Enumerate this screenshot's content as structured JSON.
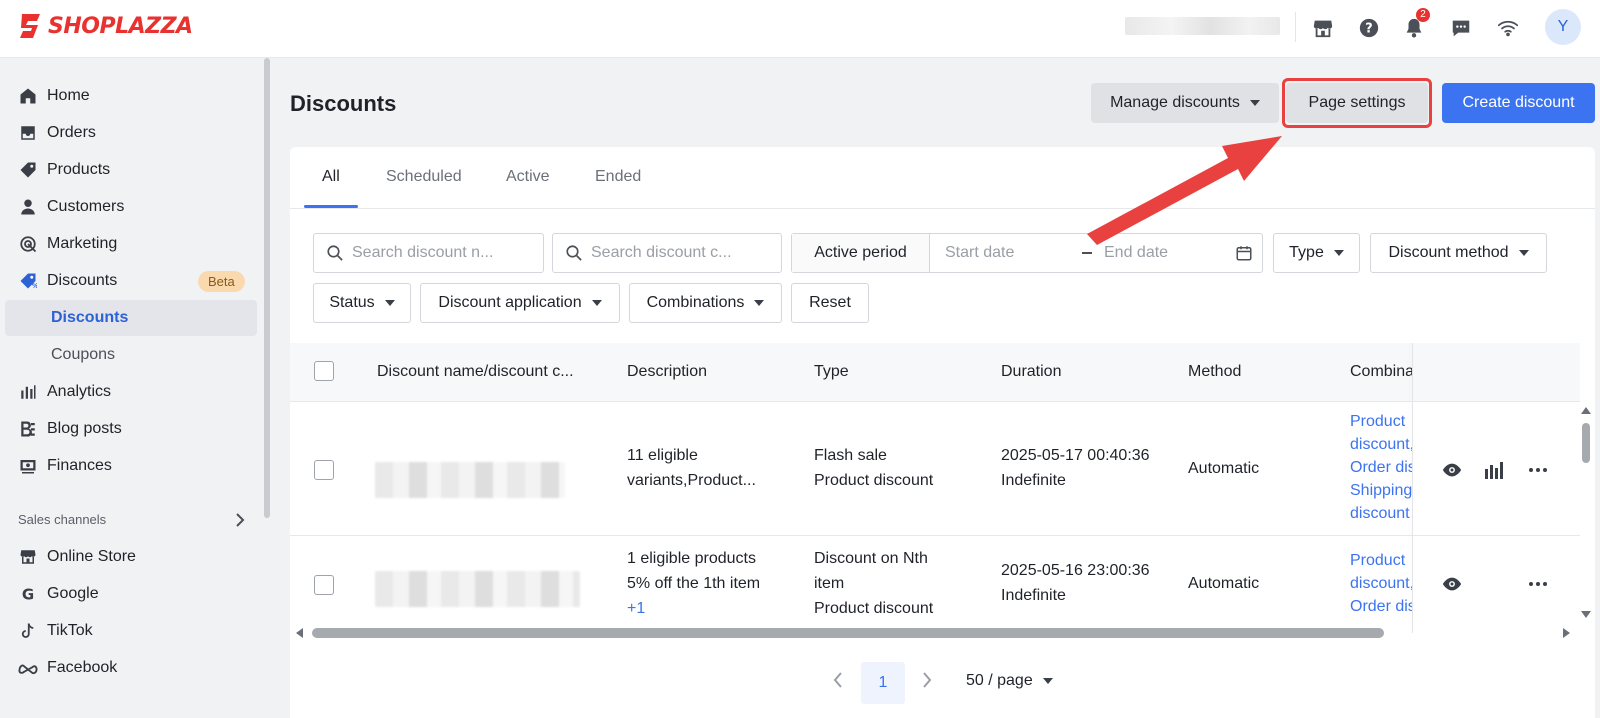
{
  "brand": {
    "name": "SHOPLAZZA",
    "accent": "#e9322f"
  },
  "topbar": {
    "notification_count": "2",
    "avatar_initial": "Y"
  },
  "sidebar": {
    "items": [
      {
        "label": "Home",
        "icon": "home-icon"
      },
      {
        "label": "Orders",
        "icon": "inbox-icon"
      },
      {
        "label": "Products",
        "icon": "tag-icon"
      },
      {
        "label": "Customers",
        "icon": "person-icon"
      },
      {
        "label": "Marketing",
        "icon": "target-icon"
      },
      {
        "label": "Discounts",
        "icon": "discount-tag-icon",
        "badge": "Beta"
      },
      {
        "label": "Discounts",
        "sub": true,
        "selected": true
      },
      {
        "label": "Coupons",
        "sub": true
      },
      {
        "label": "Analytics",
        "icon": "bar-chart-icon"
      },
      {
        "label": "Blog posts",
        "icon": "blog-icon"
      },
      {
        "label": "Finances",
        "icon": "finance-icon"
      }
    ],
    "sales_channels_label": "Sales channels",
    "channels": [
      {
        "label": "Online Store",
        "icon": "store-icon"
      },
      {
        "label": "Google",
        "icon": "google-icon"
      },
      {
        "label": "TikTok",
        "icon": "tiktok-icon"
      },
      {
        "label": "Facebook",
        "icon": "meta-icon"
      }
    ]
  },
  "page": {
    "title": "Discounts",
    "manage_label": "Manage discounts",
    "settings_label": "Page settings",
    "create_label": "Create discount",
    "primary_color": "#3c73f0"
  },
  "tabs": [
    "All",
    "Scheduled",
    "Active",
    "Ended"
  ],
  "filters": {
    "search_name_placeholder": "Search discount n...",
    "search_code_placeholder": "Search discount c...",
    "active_period_label": "Active period",
    "start_placeholder": "Start date",
    "end_placeholder": "End date",
    "type_label": "Type",
    "method_label": "Discount method",
    "status_label": "Status",
    "application_label": "Discount application",
    "combinations_label": "Combinations",
    "reset_label": "Reset"
  },
  "table": {
    "headers": [
      "Discount name/discount c...",
      "Description",
      "Type",
      "Duration",
      "Method",
      "Combina"
    ],
    "rows": [
      {
        "description": [
          "11 eligible",
          "variants,Product..."
        ],
        "type": [
          "Flash sale",
          "Product discount"
        ],
        "duration": [
          "2025-05-17 00:40:36",
          "Indefinite"
        ],
        "method": "Automatic",
        "combinations": [
          "Product",
          "discount,",
          "Order dis",
          "Shipping",
          "discount"
        ]
      },
      {
        "description": [
          "1 eligible products",
          "5% off the 1th item"
        ],
        "description_more": "+1",
        "type": [
          "Discount on Nth",
          "item",
          "Product discount"
        ],
        "duration": [
          "2025-05-16 23:00:36",
          "Indefinite"
        ],
        "method": "Automatic",
        "combinations": [
          "Product",
          "discount,",
          "Order dis"
        ]
      }
    ]
  },
  "pagination": {
    "page": "1",
    "page_size": "50 / page"
  }
}
